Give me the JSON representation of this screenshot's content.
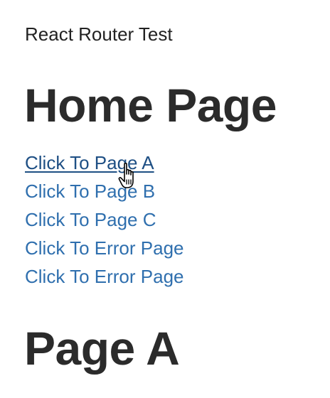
{
  "app": {
    "title": "React Router Test"
  },
  "home": {
    "heading": "Home Page"
  },
  "nav": {
    "links": [
      {
        "label": "Click To Page A"
      },
      {
        "label": "Click To Page B"
      },
      {
        "label": "Click To Page C"
      },
      {
        "label": "Click To Error Page"
      },
      {
        "label": "Click To Error Page"
      }
    ]
  },
  "route_content": {
    "heading": "Page A"
  },
  "colors": {
    "link": "#2f6fae",
    "link_hover": "#1e4f84",
    "heading": "#2b2b2b"
  },
  "cursor": {
    "icon": "hand-pointer-icon"
  }
}
